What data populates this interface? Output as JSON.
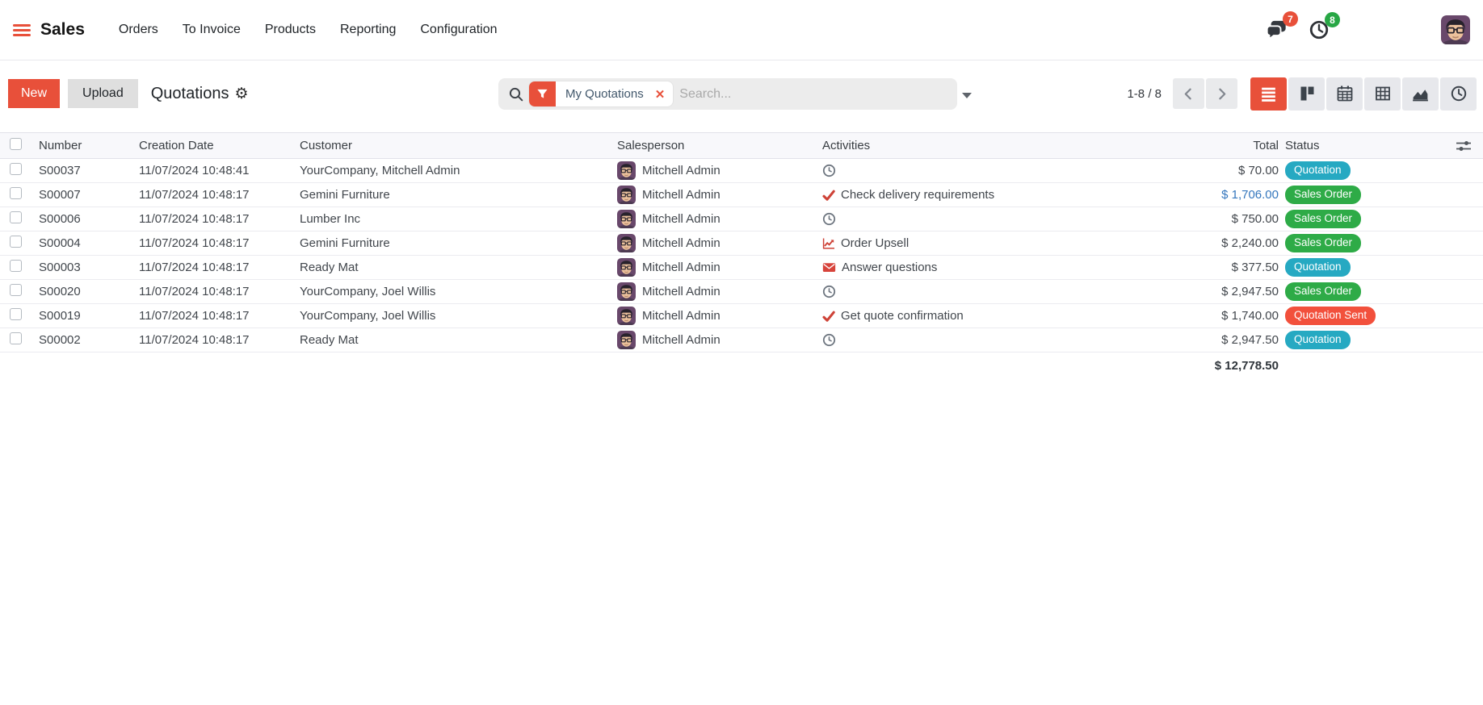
{
  "app": {
    "brand": "Sales",
    "menu": [
      "Orders",
      "To Invoice",
      "Products",
      "Reporting",
      "Configuration"
    ],
    "systray": {
      "messages_badge": "7",
      "activities_badge": "8"
    }
  },
  "control_panel": {
    "new_label": "New",
    "upload_label": "Upload",
    "title": "Quotations",
    "search_facet": "My Quotations",
    "search_placeholder": "Search...",
    "pager": "1-8 / 8",
    "view_switcher_icons": [
      "list",
      "kanban",
      "calendar",
      "pivot",
      "graph",
      "activity"
    ]
  },
  "table": {
    "headers": {
      "number": "Number",
      "date": "Creation Date",
      "customer": "Customer",
      "salesperson": "Salesperson",
      "activities": "Activities",
      "total": "Total",
      "status": "Status"
    },
    "rows": [
      {
        "number": "S00037",
        "date": "11/07/2024 10:48:41",
        "customer": "YourCompany, Mitchell Admin",
        "salesperson": "Mitchell Admin",
        "activity": {
          "icon": "clock",
          "label": ""
        },
        "total": {
          "amount": "$ 70.00",
          "tone": "normal"
        },
        "status": {
          "label": "Quotation",
          "variant": "info"
        }
      },
      {
        "number": "S00007",
        "date": "11/07/2024 10:48:17",
        "customer": "Gemini Furniture",
        "salesperson": "Mitchell Admin",
        "activity": {
          "icon": "check",
          "label": "Check delivery requirements"
        },
        "total": {
          "amount": "$ 1,706.00",
          "tone": "info"
        },
        "status": {
          "label": "Sales Order",
          "variant": "success"
        }
      },
      {
        "number": "S00006",
        "date": "11/07/2024 10:48:17",
        "customer": "Lumber Inc",
        "salesperson": "Mitchell Admin",
        "activity": {
          "icon": "clock",
          "label": ""
        },
        "total": {
          "amount": "$ 750.00",
          "tone": "normal"
        },
        "status": {
          "label": "Sales Order",
          "variant": "success"
        }
      },
      {
        "number": "S00004",
        "date": "11/07/2024 10:48:17",
        "customer": "Gemini Furniture",
        "salesperson": "Mitchell Admin",
        "activity": {
          "icon": "chart",
          "label": "Order Upsell"
        },
        "total": {
          "amount": "$ 2,240.00",
          "tone": "normal"
        },
        "status": {
          "label": "Sales Order",
          "variant": "success"
        }
      },
      {
        "number": "S00003",
        "date": "11/07/2024 10:48:17",
        "customer": "Ready Mat",
        "salesperson": "Mitchell Admin",
        "activity": {
          "icon": "envelope",
          "label": "Answer questions"
        },
        "total": {
          "amount": "$ 377.50",
          "tone": "normal"
        },
        "status": {
          "label": "Quotation",
          "variant": "info"
        }
      },
      {
        "number": "S00020",
        "date": "11/07/2024 10:48:17",
        "customer": "YourCompany, Joel Willis",
        "salesperson": "Mitchell Admin",
        "activity": {
          "icon": "clock",
          "label": ""
        },
        "total": {
          "amount": "$ 2,947.50",
          "tone": "normal"
        },
        "status": {
          "label": "Sales Order",
          "variant": "success"
        }
      },
      {
        "number": "S00019",
        "date": "11/07/2024 10:48:17",
        "customer": "YourCompany, Joel Willis",
        "salesperson": "Mitchell Admin",
        "activity": {
          "icon": "check",
          "label": "Get quote confirmation"
        },
        "total": {
          "amount": "$ 1,740.00",
          "tone": "normal"
        },
        "status": {
          "label": "Quotation Sent",
          "variant": "danger"
        }
      },
      {
        "number": "S00002",
        "date": "11/07/2024 10:48:17",
        "customer": "Ready Mat",
        "salesperson": "Mitchell Admin",
        "activity": {
          "icon": "clock",
          "label": ""
        },
        "total": {
          "amount": "$ 2,947.50",
          "tone": "normal"
        },
        "status": {
          "label": "Quotation",
          "variant": "info"
        }
      }
    ],
    "footer_total": "$ 12,778.50"
  },
  "colors": {
    "accent": "#e8503a",
    "badge_info": "#26a9c2",
    "badge_success": "#2eab47",
    "badge_danger": "#f2503c",
    "amount_info": "#3577bd"
  }
}
